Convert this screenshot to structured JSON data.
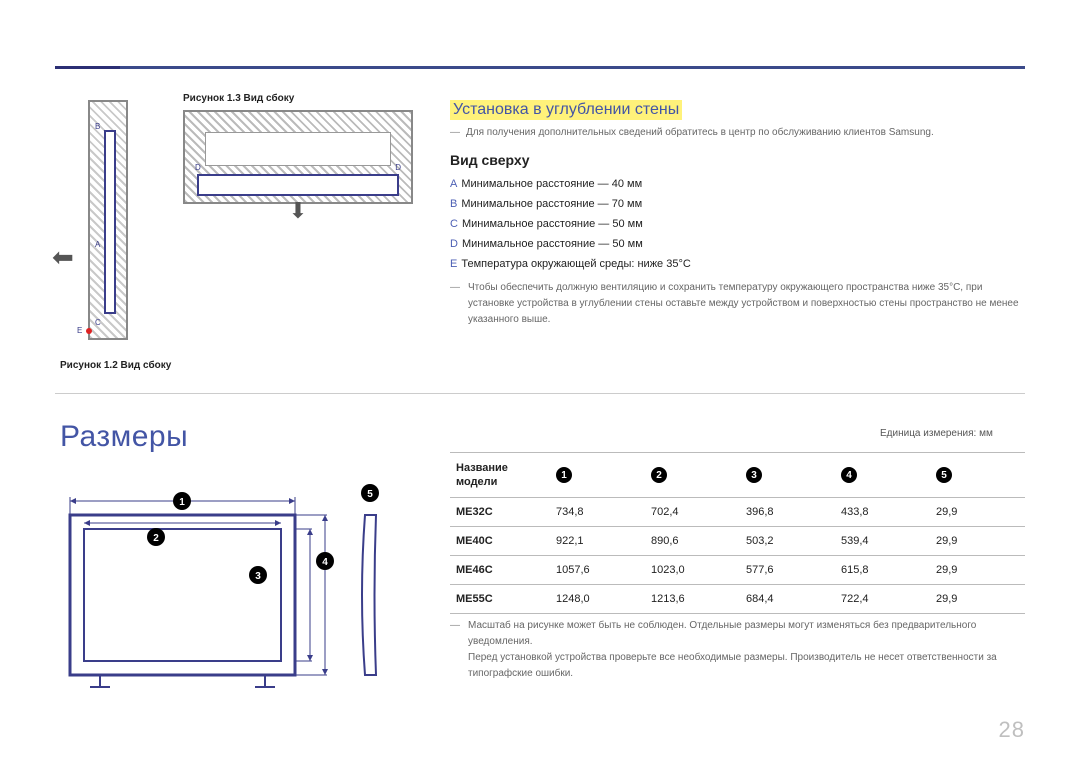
{
  "page_number": "28",
  "figures": {
    "f13_caption": "Рисунок 1.3 Вид сбоку",
    "f12_caption": "Рисунок 1.2 Вид сбоку",
    "labels": {
      "A": "A",
      "B": "B",
      "C": "C",
      "D": "D",
      "E": "E"
    }
  },
  "section_install": {
    "title": "Установка в углублении стены",
    "note": "Для получения дополнительных сведений обратитесь в центр по обслуживанию клиентов Samsung.",
    "subhead": "Вид сверху",
    "dist": [
      {
        "k": "A",
        "t": "Минимальное расстояние — 40 мм"
      },
      {
        "k": "B",
        "t": "Минимальное расстояние — 70 мм"
      },
      {
        "k": "C",
        "t": "Минимальное расстояние — 50 мм"
      },
      {
        "k": "D",
        "t": "Минимальное расстояние — 50 мм"
      },
      {
        "k": "E",
        "t": "Температура окружающей среды: ниже 35°C"
      }
    ],
    "vent": "Чтобы обеспечить должную вентиляцию и сохранить температуру окружающего пространства ниже 35°C, при установке устройства в углублении стены оставьте между устройством и поверхностью стены пространство не менее указанного выше."
  },
  "section_dim": {
    "title": "Размеры",
    "unit": "Единица измерения: мм",
    "header_model": "Название модели",
    "cols": [
      "1",
      "2",
      "3",
      "4",
      "5"
    ],
    "rows": [
      {
        "model": "ME32C",
        "v": [
          "734,8",
          "702,4",
          "396,8",
          "433,8",
          "29,9"
        ]
      },
      {
        "model": "ME40C",
        "v": [
          "922,1",
          "890,6",
          "503,2",
          "539,4",
          "29,9"
        ]
      },
      {
        "model": "ME46C",
        "v": [
          "1057,6",
          "1023,0",
          "577,6",
          "615,8",
          "29,9"
        ]
      },
      {
        "model": "ME55C",
        "v": [
          "1248,0",
          "1213,6",
          "684,4",
          "722,4",
          "29,9"
        ]
      }
    ],
    "footnote1": "Масштаб на рисунке может быть не соблюден. Отдельные размеры могут изменяться без предварительного уведомления.",
    "footnote2": "Перед установкой устройства проверьте все необходимые размеры. Производитель не несет ответственности за типографские ошибки."
  },
  "chart_data": {
    "type": "table",
    "title": "Размеры",
    "unit": "мм",
    "columns": [
      "Название модели",
      "1",
      "2",
      "3",
      "4",
      "5"
    ],
    "rows": [
      [
        "ME32C",
        734.8,
        702.4,
        396.8,
        433.8,
        29.9
      ],
      [
        "ME40C",
        922.1,
        890.6,
        503.2,
        539.4,
        29.9
      ],
      [
        "ME46C",
        1057.6,
        1023.0,
        577.6,
        615.8,
        29.9
      ],
      [
        "ME55C",
        1248.0,
        1213.6,
        684.4,
        722.4,
        29.9
      ]
    ]
  }
}
